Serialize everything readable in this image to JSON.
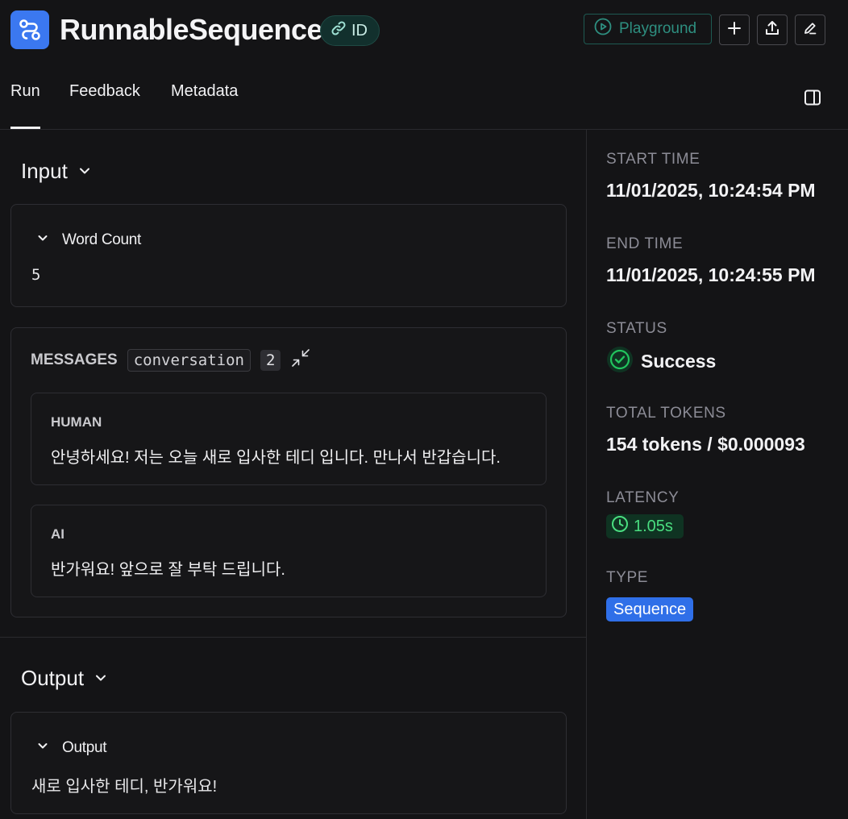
{
  "header": {
    "title": "RunnableSequence",
    "id_label": "ID",
    "playground_label": "Playground",
    "icons": [
      "add-icon",
      "share-upload-icon",
      "edit-icon"
    ]
  },
  "tabs": [
    {
      "label": "Run",
      "active": true
    },
    {
      "label": "Feedback",
      "active": false
    },
    {
      "label": "Metadata",
      "active": false
    }
  ],
  "input": {
    "heading": "Input",
    "word_count": {
      "label": "Word Count",
      "value": "5"
    },
    "messages": {
      "label": "MESSAGES",
      "tag": "conversation",
      "count": "2",
      "items": [
        {
          "role": "HUMAN",
          "text": "안녕하세요! 저는 오늘 새로 입사한 테디 입니다. 만나서 반갑습니다."
        },
        {
          "role": "AI",
          "text": "반가워요! 앞으로 잘 부탁 드립니다."
        }
      ]
    }
  },
  "output": {
    "heading": "Output",
    "field_label": "Output",
    "value": "새로 입사한 테디, 반가워요!"
  },
  "details": {
    "start_time_label": "START TIME",
    "start_time": "11/01/2025, 10:24:54 PM",
    "end_time_label": "END TIME",
    "end_time": "11/01/2025, 10:24:55 PM",
    "status_label": "STATUS",
    "status": "Success",
    "total_tokens_label": "TOTAL TOKENS",
    "total_tokens": "154 tokens / $0.000093",
    "latency_label": "LATENCY",
    "latency": "1.05s",
    "type_label": "TYPE",
    "type": "Sequence"
  },
  "colors": {
    "background": "#141416",
    "logo": "#3b78f0",
    "success": "#22c55e",
    "latency_bg": "#0f3322",
    "type_badge": "#2f6fe8",
    "playground": "#2e8f80"
  }
}
